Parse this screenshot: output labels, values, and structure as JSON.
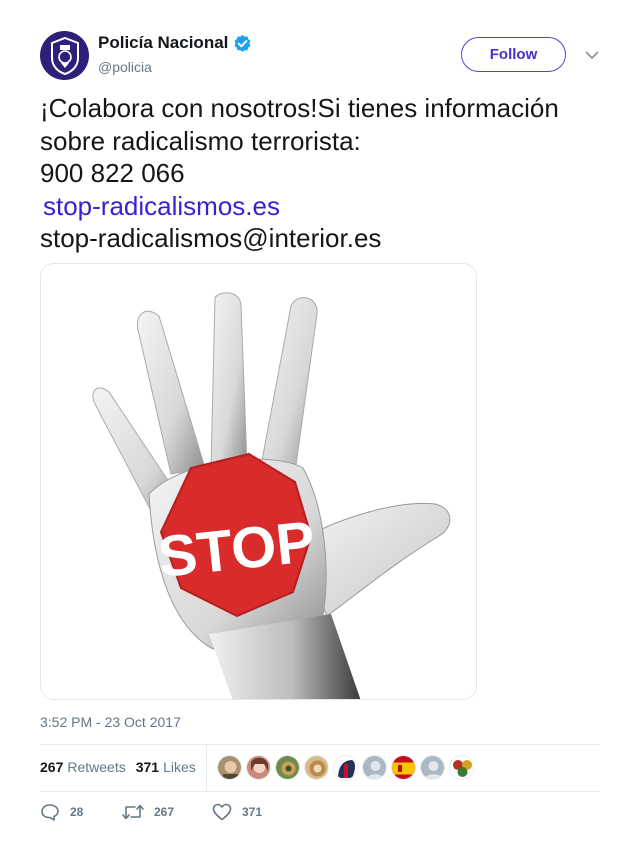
{
  "author": {
    "display_name": "Policía Nacional",
    "handle": "@policia",
    "verified": true,
    "avatar_icon": "police-emblem-icon",
    "avatar_color": "#2d1f7a"
  },
  "follow_label": "Follow",
  "tweet": {
    "line1": "¡Colabora con nosotros!Si tienes información",
    "line2": "sobre radicalismo terrorista:",
    "phone": "900 822 066",
    "link": "stop-radicalismos.es",
    "email": "stop-radicalismos@interior.es"
  },
  "media": {
    "sign_text": "STOP",
    "sign_color": "#d92b2b"
  },
  "timestamp": "3:52 PM - 23 Oct 2017",
  "stats": {
    "retweets_count": "267",
    "retweets_label": "Retweets",
    "likes_count": "371",
    "likes_label": "Likes"
  },
  "likers": [
    {
      "icon": "liker-avatar-1",
      "color": "#a89070"
    },
    {
      "icon": "liker-avatar-2",
      "color": "#c98a7a"
    },
    {
      "icon": "liker-avatar-3",
      "color": "#6f8a4a"
    },
    {
      "icon": "liker-avatar-4",
      "color": "#d9b98a"
    },
    {
      "icon": "liker-avatar-5",
      "color": "#223355"
    },
    {
      "icon": "liker-avatar-6",
      "color": "#aab8c2"
    },
    {
      "icon": "spain-flag-icon",
      "color": "#c60b1e"
    },
    {
      "icon": "liker-avatar-8",
      "color": "#aab8c2"
    },
    {
      "icon": "liker-avatar-9",
      "color": "#b83020"
    }
  ],
  "actions": {
    "reply_count": "28",
    "retweet_count": "267",
    "like_count": "371"
  }
}
